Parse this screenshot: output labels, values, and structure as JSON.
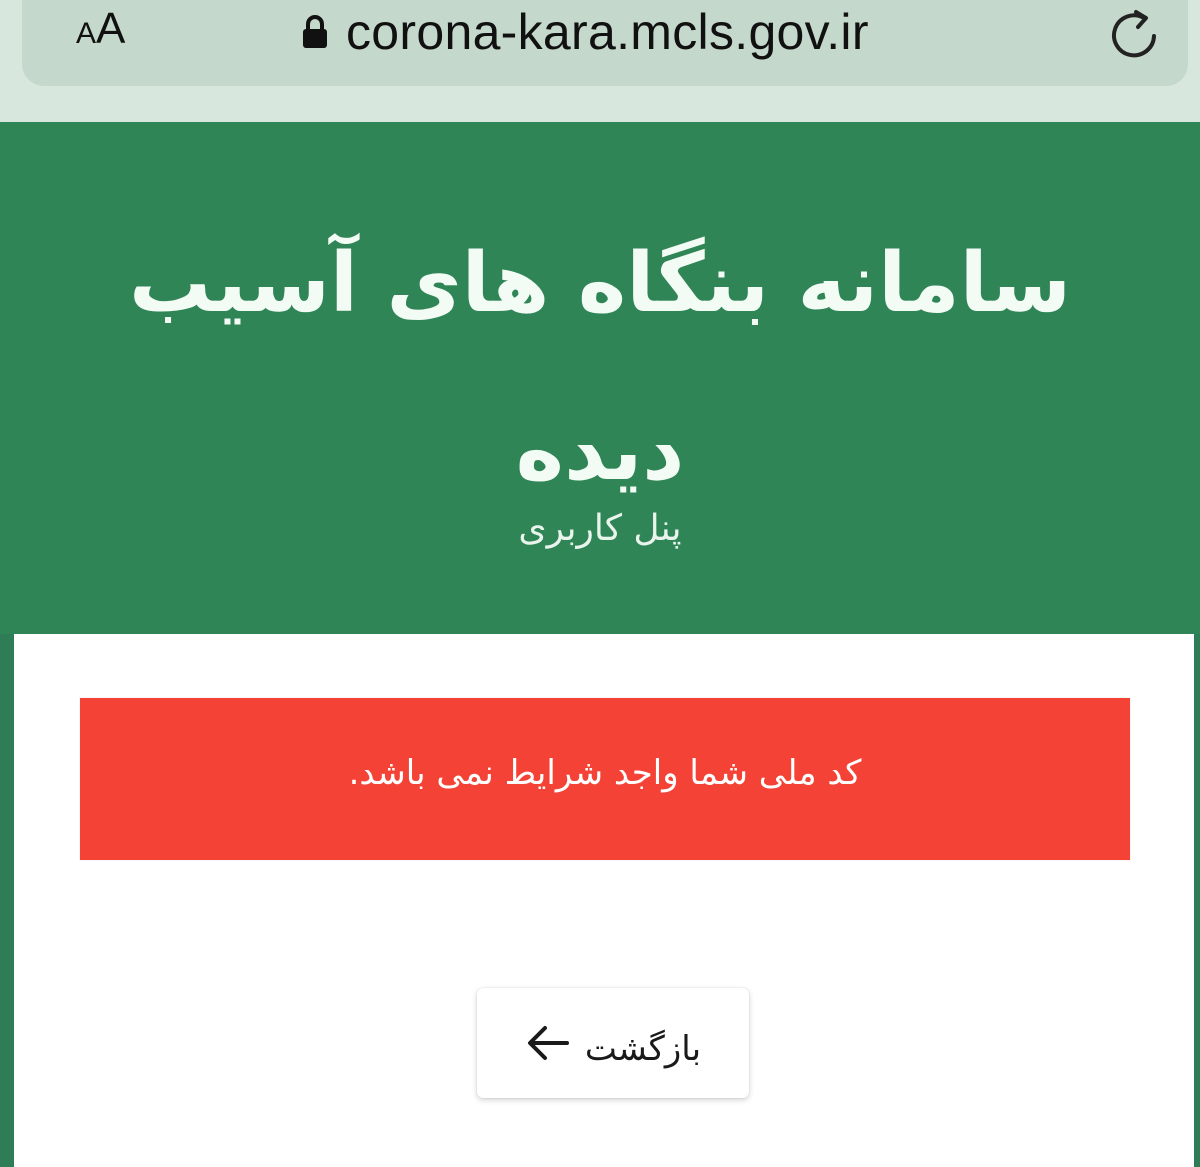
{
  "browser": {
    "text_size_small": "A",
    "text_size_large": "A",
    "url": "corona-kara.mcls.gov.ir",
    "lock_icon": "lock-icon",
    "reload_icon": "reload-icon"
  },
  "header": {
    "title": "سامانه بنگاه های آسیب دیده",
    "subtitle": "پنل کاربری"
  },
  "alert": {
    "message": "کد ملی شما واجد شرایط نمی باشد."
  },
  "actions": {
    "back_label": "بازگشت",
    "back_icon": "arrow-left-icon"
  },
  "colors": {
    "header_green": "#2f8556",
    "alert_red": "#f44336",
    "panel_white": "#ffffff"
  }
}
